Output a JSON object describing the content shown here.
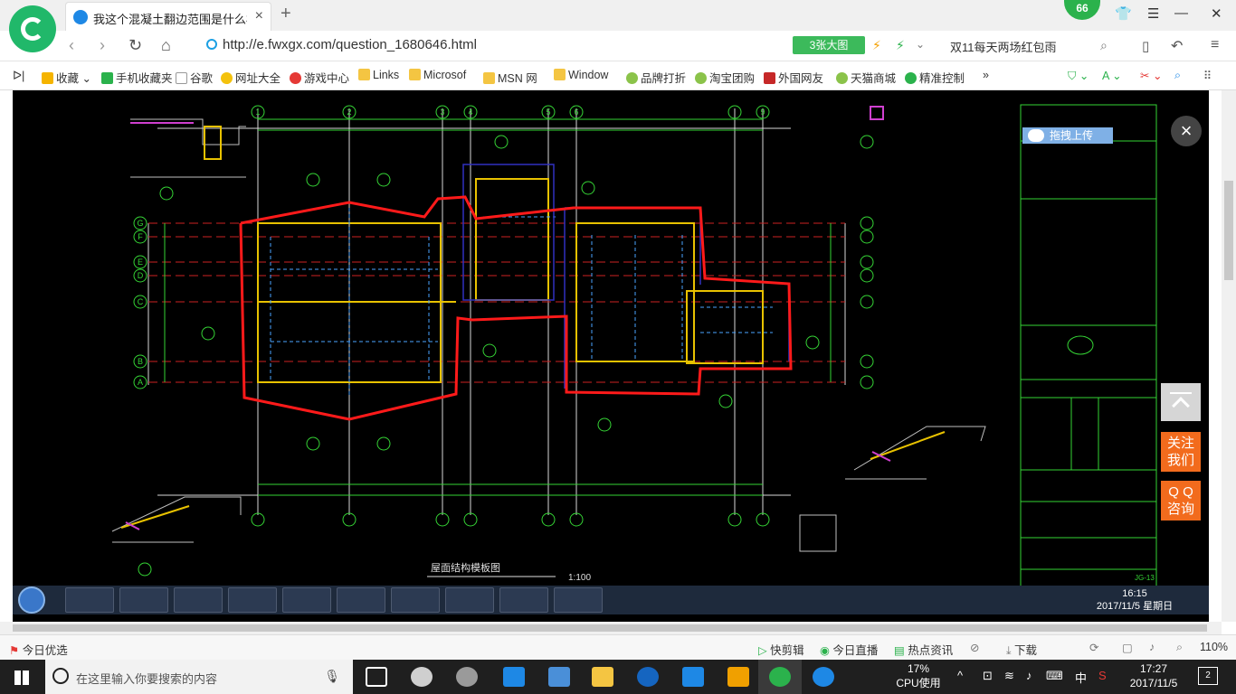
{
  "browser": {
    "badge_count": "66",
    "tab_title": "我这个混凝土翻边范围是什么样的",
    "tab_close": "×",
    "new_tab": "+",
    "url": "http://e.fwxgx.com/question_1680646.html",
    "big_pic_label": "3张大图",
    "promo_text": "双11每天两场红包雨"
  },
  "bookmarks": [
    {
      "label": "收藏",
      "color": "#f5b400"
    },
    {
      "label": "手机收藏夹",
      "color": "#2bb24c"
    },
    {
      "label": "谷歌",
      "color": "#ffffff"
    },
    {
      "label": "网址大全",
      "color": "#f4c20d"
    },
    {
      "label": "游戏中心",
      "color": "#e53935"
    },
    {
      "label": "Links",
      "color": "#f4c542"
    },
    {
      "label": "Microsof",
      "color": "#f4c542"
    },
    {
      "label": "MSN 网",
      "color": "#f4c542"
    },
    {
      "label": "Window",
      "color": "#f4c542"
    },
    {
      "label": "品牌打折",
      "color": "#8bc34a"
    },
    {
      "label": "淘宝团购",
      "color": "#8bc34a"
    },
    {
      "label": "外国网友",
      "color": "#c62828"
    },
    {
      "label": "天猫商城",
      "color": "#8bc34a"
    },
    {
      "label": "精准控制",
      "color": "#2bb24c"
    }
  ],
  "viewer": {
    "upload_label": "拖拽上传",
    "close_symbol": "×",
    "side_follow_1": "关注",
    "side_follow_2": "我们",
    "side_qq_1": "Q Q",
    "side_qq_2": "咨询"
  },
  "drawing": {
    "title": "屋面结构模板图",
    "scale": "1:100",
    "axis_numbers_top": [
      "1",
      "2",
      "3",
      "4",
      "5",
      "6",
      "9"
    ],
    "axis_letters": [
      "G",
      "F",
      "E",
      "D",
      "C",
      "B",
      "A"
    ],
    "sheet_no": "JG-13"
  },
  "inner_taskbar": {
    "time": "16:15",
    "date": "2017/11/5 星期日",
    "apps": [
      "explorer",
      "ie",
      "baidu-cloud",
      "calculator",
      "notepad",
      "cad",
      "excel",
      "word",
      "folder",
      "app"
    ]
  },
  "statusbar": {
    "left": "今日优选",
    "items": [
      "快剪辑",
      "今日直播",
      "热点资讯",
      "下载"
    ],
    "zoom": "110%"
  },
  "taskbar": {
    "search_placeholder": "在这里输入你要搜索的内容",
    "cpu_pct": "17%",
    "cpu_label": "CPU使用",
    "ime": "中",
    "time": "17:27",
    "date": "2017/11/5",
    "notif_count": "2"
  },
  "colors": {
    "accent_green": "#2bb24c",
    "side_orange": "#f26b1d",
    "outline_red": "#ff1a1a"
  }
}
